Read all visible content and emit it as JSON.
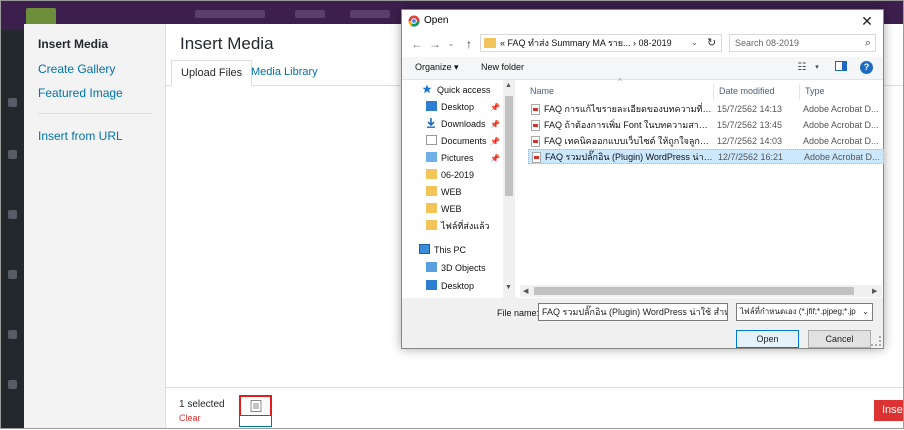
{
  "media_modal": {
    "menu": {
      "insert_media": "Insert Media",
      "create_gallery": "Create Gallery",
      "featured_image": "Featured Image",
      "insert_from_url": "Insert from URL"
    },
    "title": "Insert Media",
    "tabs": {
      "upload": "Upload Files",
      "library": "Media Library"
    },
    "toolbar": {
      "selected": "1 selected",
      "clear": "Clear",
      "insert": "Inse"
    }
  },
  "open_dialog": {
    "title": "Open",
    "close": "✕",
    "address": "«  FAQ ทำส่ง Summary MA ราย...  ›  08-2019",
    "search_placeholder": "Search 08-2019",
    "commands": {
      "organize": "Organize ▾",
      "new_folder": "New folder"
    },
    "nav": [
      {
        "label": "Quick access",
        "icon": "star-icon"
      },
      {
        "label": "Desktop",
        "icon": "desktop-icon",
        "pinned": true
      },
      {
        "label": "Downloads",
        "icon": "download-icon",
        "pinned": true
      },
      {
        "label": "Documents",
        "icon": "document-icon",
        "pinned": true
      },
      {
        "label": "Pictures",
        "icon": "picture-icon",
        "pinned": true
      },
      {
        "label": "06-2019",
        "icon": "folder-icon"
      },
      {
        "label": "WEB",
        "icon": "folder-icon"
      },
      {
        "label": "WEB",
        "icon": "folder-icon"
      },
      {
        "label": "ไฟล์ที่ส่งแล้ว",
        "icon": "folder-icon"
      },
      {
        "label": "This PC",
        "icon": "computer-icon"
      },
      {
        "label": "3D Objects",
        "icon": "cube-icon"
      },
      {
        "label": "Desktop",
        "icon": "desktop-icon"
      }
    ],
    "columns": {
      "name": "Name",
      "date": "Date modified",
      "type": "Type"
    },
    "files": [
      {
        "name": "FAQ การแก้ไขรายละเอียดของบทความที่มีอยู่ในห...",
        "date": "15/7/2562 14:13",
        "type": "Adobe Acrobat D..."
      },
      {
        "name": "FAQ ถ้าต้องการเพิ่ม Font ในบทความสามารถทำ...",
        "date": "15/7/2562 13:45",
        "type": "Adobe Acrobat D..."
      },
      {
        "name": "FAQ เทคนิคออกแบบเว็บไซต์ ให้ถูกใจลูกค้า.pdf",
        "date": "12/7/2562 14:03",
        "type": "Adobe Acrobat D..."
      },
      {
        "name": "FAQ รวมปลั๊กอิน (Plugin) WordPress น่าใช้ ส...",
        "date": "12/7/2562 16:21",
        "type": "Adobe Acrobat D..."
      }
    ],
    "selected_file_index": 3,
    "file_name_label": "File name:",
    "file_name_value": "FAQ รวมปลั๊กอิน (Plugin) WordPress น่าใช้ สำหรั",
    "file_type_value": "ไฟล์ที่กำหนดเอง (*.jfif;*.pjpeg;*.jp",
    "open_button": "Open",
    "cancel_button": "Cancel"
  }
}
